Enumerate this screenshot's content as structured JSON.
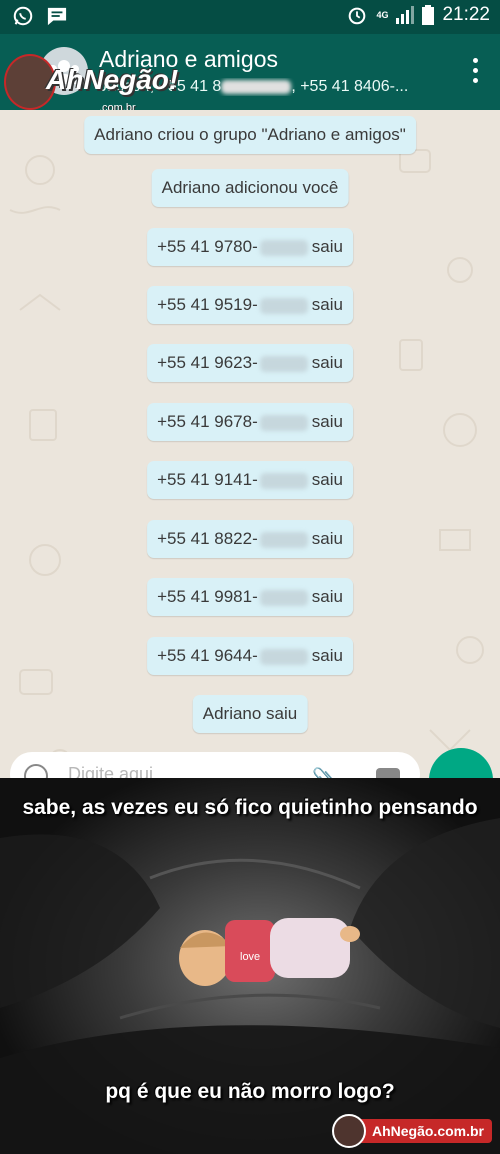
{
  "status_bar": {
    "time": "21:22",
    "network": "4G"
  },
  "header": {
    "title": "Adriano e amigos",
    "subtitle_a": "Jacson, +55 41 8",
    "subtitle_b": ", +55 41 8406-...",
    "watermark_word": "AhNegão!",
    "watermark_sub": ".com.br"
  },
  "messages": [
    {
      "text": "Adriano criou o grupo \"Adriano e amigos\""
    },
    {
      "text": "Adriano adicionou você"
    },
    {
      "prefix": "+55 41 9780-",
      "suffix": "saiu"
    },
    {
      "prefix": "+55 41 9519-",
      "suffix": "saiu"
    },
    {
      "prefix": "+55 41 9623-",
      "suffix": "saiu"
    },
    {
      "prefix": "+55 41 9678-",
      "suffix": "saiu"
    },
    {
      "prefix": "+55 41 9141-",
      "suffix": "saiu"
    },
    {
      "prefix": "+55 41 8822-",
      "suffix": "saiu"
    },
    {
      "prefix": "+55 41 9981-",
      "suffix": "saiu"
    },
    {
      "prefix": "+55 41 9644-",
      "suffix": "saiu"
    },
    {
      "text": "Adriano saiu"
    }
  ],
  "input": {
    "placeholder": "Digite aqui"
  },
  "meme": {
    "caption_top": "sabe, as vezes eu só fico quietinho pensando",
    "caption_bottom": "pq é que eu não morro logo?",
    "doll_label": "love",
    "site": "AhNegão.com.br"
  },
  "colors": {
    "header": "#075e54",
    "statusbar": "#054d44",
    "system_bubble": "#d9f1f7",
    "chat_bg": "#ebe5dc",
    "mic": "#00a884"
  }
}
